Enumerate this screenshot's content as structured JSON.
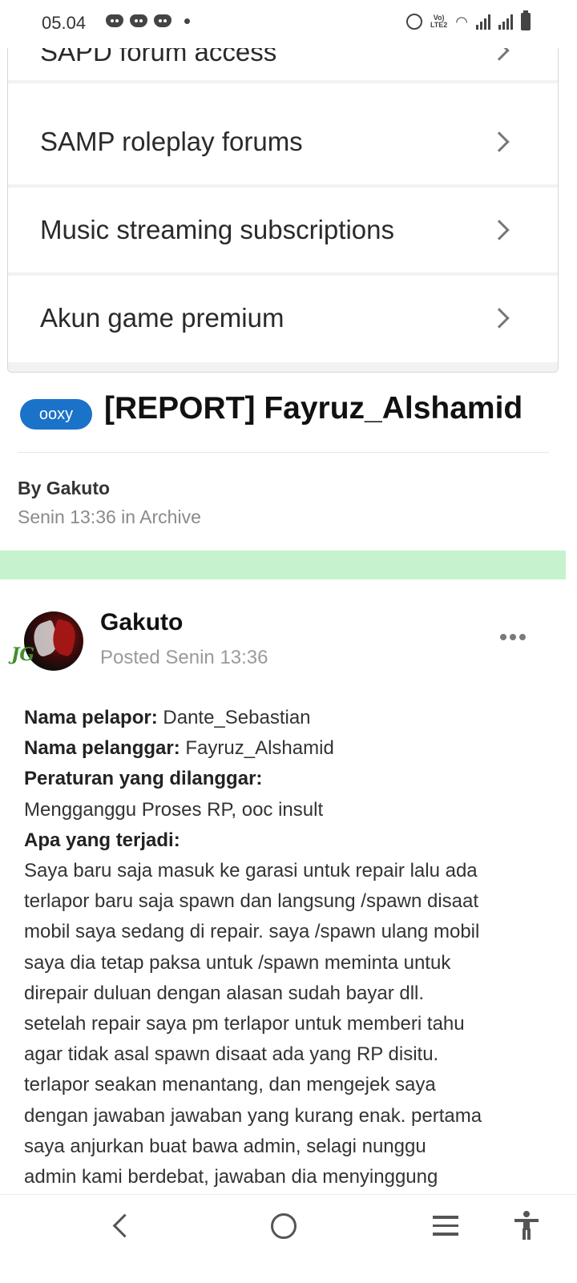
{
  "status_bar": {
    "time": "05.04",
    "volte_label": "VoLTE2"
  },
  "menu": {
    "items": [
      {
        "label": "SAPD forum access"
      },
      {
        "label": "SAMP roleplay forums"
      },
      {
        "label": "Music streaming subscriptions"
      },
      {
        "label": "Akun game premium"
      }
    ]
  },
  "topic": {
    "prefix": "ooxy",
    "title": "[REPORT] Fayruz_Alshamid",
    "by": "By Gakuto",
    "meta": "Senin 13:36 in Archive"
  },
  "post": {
    "author": "Gakuto",
    "author_badge": "JG",
    "posted": "Posted Senin 13:36",
    "reporter_label": "Nama pelapor:",
    "reporter_value": "Dante_Sebastian",
    "offender_label": "Nama pelanggar:",
    "offender_value": "Fayruz_Alshamid",
    "rule_label": "Peraturan yang dilanggar:",
    "rule_value": "Mengganggu Proses RP, ooc insult",
    "what_label": "Apa yang terjadi:",
    "body_lines": [
      "Saya baru saja masuk ke garasi untuk repair lalu ada",
      "terlapor baru saja spawn dan langsung /spawn disaat",
      "mobil saya sedang di repair. saya /spawn ulang mobil",
      "saya dia tetap paksa untuk /spawn meminta untuk",
      "direpair duluan dengan alasan sudah bayar dll.",
      "setelah repair saya pm terlapor untuk memberi tahu",
      "agar tidak asal spawn disaat ada yang RP disitu.",
      "terlapor seakan menantang, dan mengejek saya",
      "dengan jawaban jawaban yang kurang enak. pertama",
      "saya anjurkan buat bawa admin, selagi nunggu",
      "admin kami berdebat, jawaban dia menyinggung"
    ]
  },
  "colors": {
    "prefix_bg": "#1a73c9",
    "band": "#c6f2cd"
  }
}
